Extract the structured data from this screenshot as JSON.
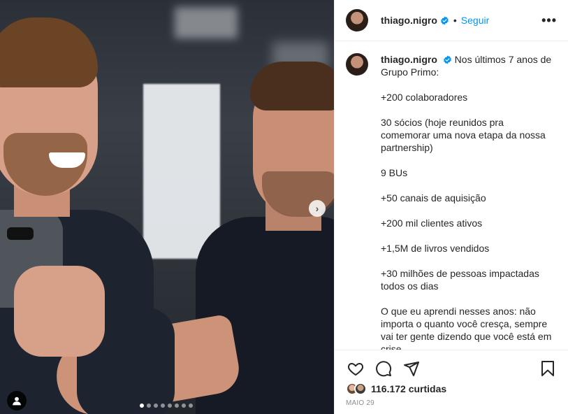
{
  "post": {
    "username": "thiago.nigro",
    "follow_label": "Seguir",
    "separator": "•",
    "more_label": "•••",
    "caption_paragraphs": [
      "Nos últimos 7 anos de Grupo Primo:",
      "+200 colaboradores",
      "30 sócios (hoje reunidos pra comemorar uma nova etapa da nossa partnership)",
      "9 BUs",
      "+50 canais de aquisição",
      "+200 mil clientes ativos",
      "+1,5M de livros vendidos",
      "+30 milhões de pessoas impactadas todos os dias",
      "O que eu aprendi nesses anos: não importa o quanto você cresça, sempre vai ter gente dizendo que você está em crise"
    ],
    "likes_text": "116.172 curtidas",
    "date": "MAIO 29"
  },
  "media": {
    "next_icon": "›",
    "carousel": {
      "count": 8,
      "active": 0
    }
  },
  "icons": {
    "verified": "verified-badge-icon",
    "like": "heart-icon",
    "comment": "comment-icon",
    "share": "share-icon",
    "save": "bookmark-icon",
    "tag": "user-tag-icon",
    "next": "chevron-right-icon"
  },
  "colors": {
    "accent": "#0095f6",
    "text": "#262626",
    "muted": "#8e8e8e",
    "border": "#efefef"
  }
}
